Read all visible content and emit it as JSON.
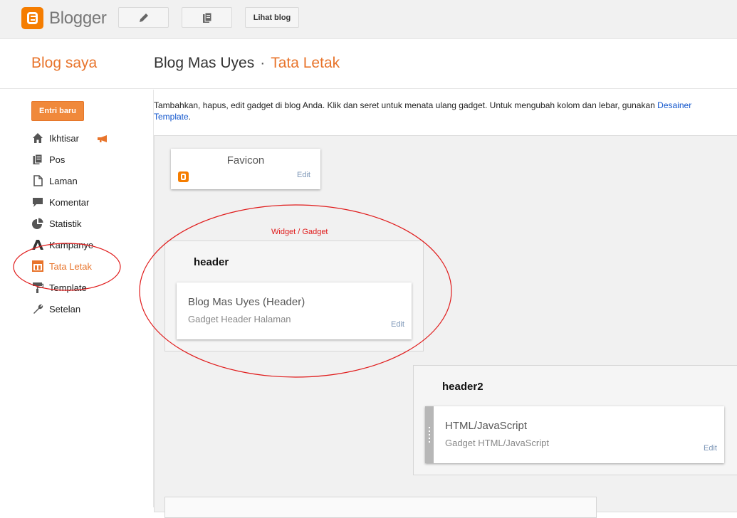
{
  "topbar": {
    "app_name": "Blogger",
    "view_blog": "Lihat blog"
  },
  "header": {
    "blog_saya": "Blog saya",
    "blog_name": "Blog Mas Uyes",
    "separator": "·",
    "page": "Tata Letak"
  },
  "sidebar": {
    "new_post": "Entri baru",
    "items": [
      {
        "label": "Ikhtisar",
        "icon": "home-icon"
      },
      {
        "label": "Pos",
        "icon": "posts-icon"
      },
      {
        "label": "Laman",
        "icon": "page-icon"
      },
      {
        "label": "Komentar",
        "icon": "comment-icon"
      },
      {
        "label": "Statistik",
        "icon": "pie-chart-icon"
      },
      {
        "label": "Kampanye",
        "icon": "adwords-icon"
      },
      {
        "label": "Tata Letak",
        "icon": "layout-icon"
      },
      {
        "label": "Template",
        "icon": "paint-roller-icon"
      },
      {
        "label": "Setelan",
        "icon": "wrench-icon"
      }
    ]
  },
  "content": {
    "description": "Tambahkan, hapus, edit gadget di blog Anda. Klik dan seret untuk menata ulang gadget. Untuk mengubah kolom dan lebar, gunakan ",
    "designer_link": "Desainer Template",
    "period": "."
  },
  "layout": {
    "favicon": {
      "title": "Favicon",
      "edit": "Edit"
    },
    "annotation": "Widget / Gadget",
    "header_section": {
      "title": "header",
      "gadget_title": "Blog Mas Uyes (Header)",
      "gadget_sub": "Gadget Header Halaman",
      "edit": "Edit"
    },
    "header2_section": {
      "title": "header2",
      "gadget_title": "HTML/JavaScript",
      "gadget_sub": "Gadget HTML/JavaScript",
      "edit": "Edit"
    }
  },
  "colors": {
    "accent": "#e8742b",
    "annotation": "#e01b1b",
    "link": "#1155cc"
  }
}
